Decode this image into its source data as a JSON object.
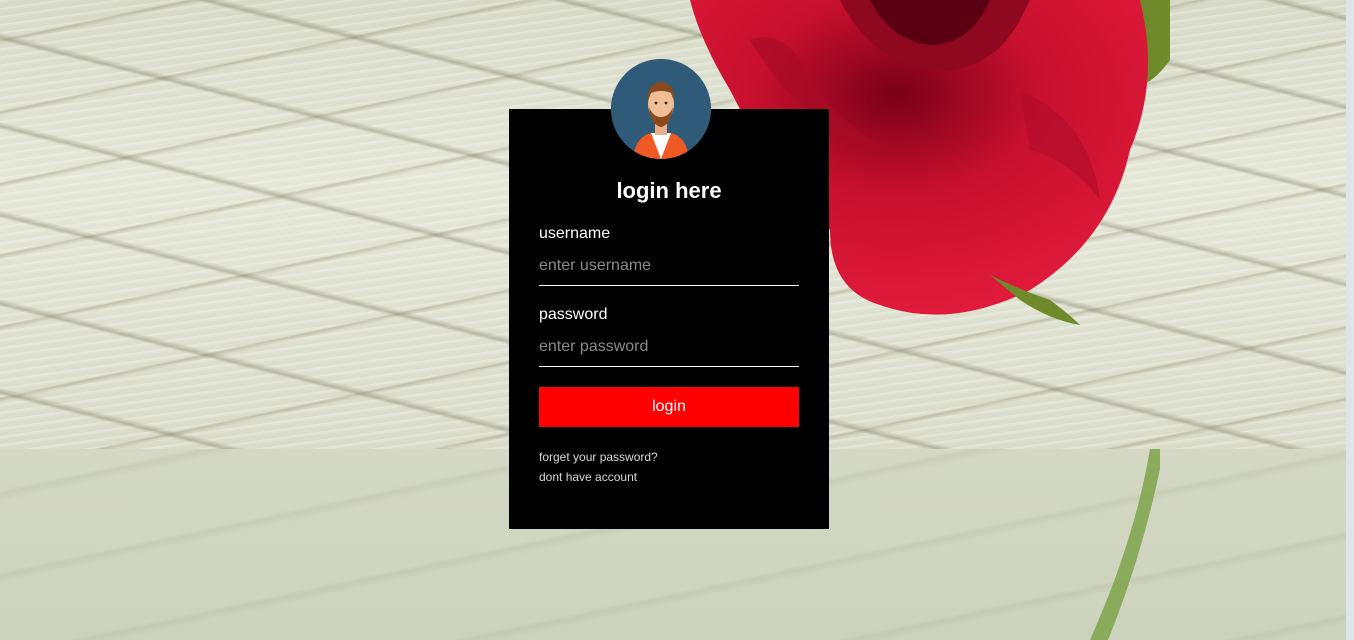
{
  "form": {
    "title": "login here",
    "username_label": "username",
    "username_placeholder": "enter username",
    "password_label": "password",
    "password_placeholder": "enter password",
    "submit_label": "login",
    "forgot_link": "forget your password?",
    "signup_link": "dont have account"
  },
  "icons": {
    "avatar": "user-avatar-icon"
  },
  "colors": {
    "box_background": "#000000",
    "button": "#ff0000",
    "avatar_background": "#2f5a78",
    "text": "#ffffff"
  }
}
